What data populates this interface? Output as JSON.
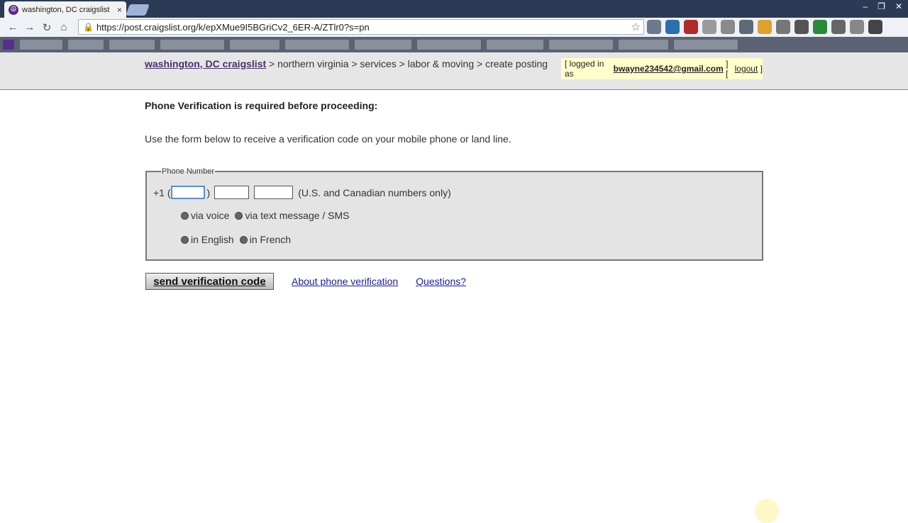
{
  "browser": {
    "tab_title": "washington, DC craigslist",
    "tab_close": "×",
    "window_controls": [
      "–",
      "❐",
      "✕"
    ],
    "url": "https://post.craigslist.org/k/epXMue9I5BGriCv2_6ER-A/ZTlr0?s=pn"
  },
  "header": {
    "site_link": "washington, DC craigslist",
    "crumbs": " > northern virginia > services > labor & moving > create posting",
    "login_prefix": "[ logged in as ",
    "login_email": "bwayne234542@gmail.com",
    "login_mid": " ] [ ",
    "logout_label": "logout",
    "login_suffix": " ]"
  },
  "main": {
    "heading": "Phone Verification is required before proceeding:",
    "instructions": "Use the form below to receive a verification code on your mobile phone or land line.",
    "legend": "Phone Number",
    "country_prefix": "+1 (",
    "paren_close": ")",
    "numbers_note": "(U.S. and Canadian numbers only)",
    "method_voice": "via voice",
    "method_sms": "via text message / SMS",
    "lang_english": "in English",
    "lang_french": "in French"
  },
  "actions": {
    "send_label": "send verification code",
    "about_link": "About phone verification",
    "questions_link": "Questions?"
  }
}
